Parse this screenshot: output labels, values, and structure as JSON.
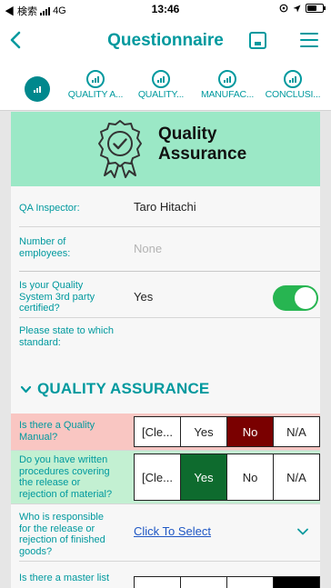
{
  "status_bar": {
    "carrier": "◀ 検索",
    "network": "4G",
    "time": "13:46"
  },
  "header": {
    "title": "Questionnaire"
  },
  "tabs": [
    {
      "label": "QUALITY A..."
    },
    {
      "label": "QUALITY..."
    },
    {
      "label": "MANUFAC..."
    },
    {
      "label": "CONCLUSI..."
    }
  ],
  "banner": {
    "title_line1": "Quality",
    "title_line2": "Assurance"
  },
  "fields": {
    "qa_inspector": {
      "label": "QA Inspector:",
      "value": "Taro Hitachi"
    },
    "employees": {
      "label_line1": "Number of",
      "label_line2": "employees:",
      "placeholder": "None"
    },
    "certified": {
      "label_line1": "Is your Quality",
      "label_line2": "System 3rd party",
      "label_line3": "certified?",
      "value": "Yes",
      "toggle_on": true
    },
    "standard": {
      "label_line1": "Please state to which",
      "label_line2": "standard:"
    }
  },
  "section": {
    "title": "QUALITY ASSURANCE"
  },
  "questions": [
    {
      "lines": [
        "Is there a Quality",
        "Manual?"
      ],
      "options": [
        "[Cle...",
        "Yes",
        "No",
        "N/A"
      ],
      "selected": "No"
    },
    {
      "lines": [
        "Do you have written",
        "procedures covering",
        "the release or",
        "rejection of material?"
      ],
      "options": [
        "[Cle...",
        "Yes",
        "No",
        "N/A"
      ],
      "selected": "Yes"
    },
    {
      "lines": [
        "Who is responsible",
        "for the release or",
        "rejection of finished",
        "goods?"
      ],
      "link": "Click To Select"
    },
    {
      "lines": [
        "Is there a master list"
      ]
    }
  ],
  "colors": {
    "accent": "#00999e",
    "banner": "#9be8c6",
    "no_row_bg": "#f9c6c2",
    "no_selected": "#7a0000",
    "yes_row_bg": "#c3f0d2",
    "yes_selected": "#0e6b2e",
    "toggle_on": "#27b551",
    "link": "#1f57c4"
  }
}
